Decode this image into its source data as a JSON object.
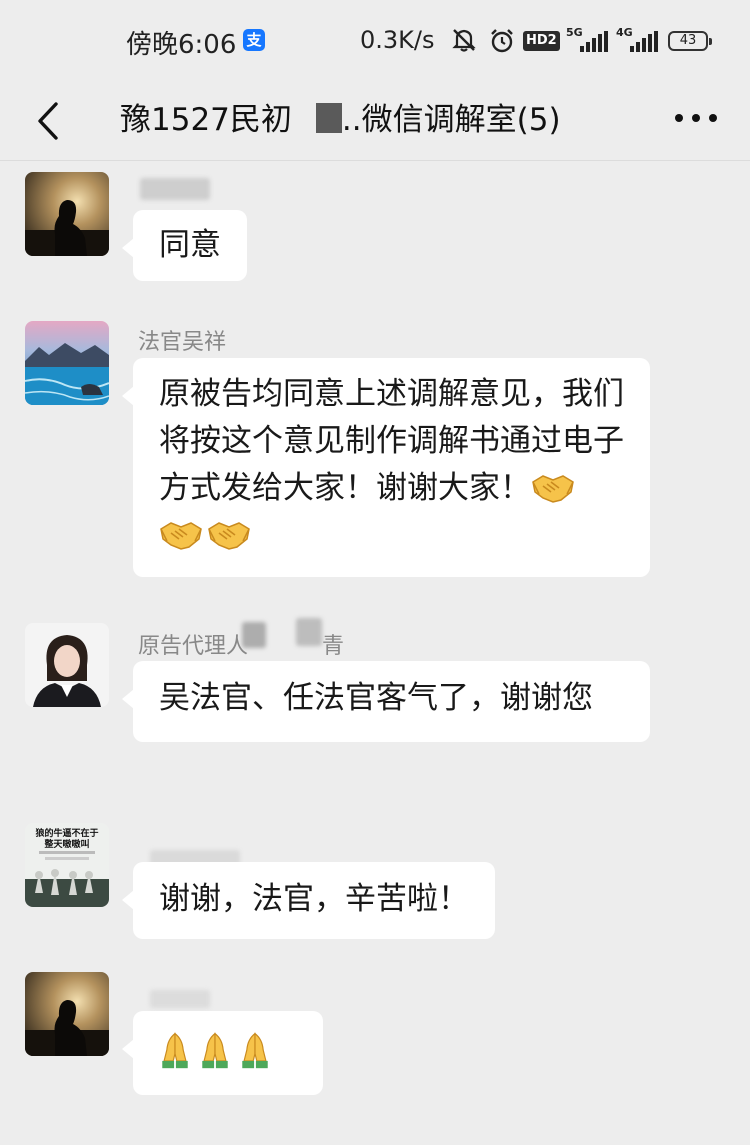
{
  "status_bar": {
    "time": "傍晚6:06",
    "alipay_badge": "支",
    "net_speed": "0.3K/s",
    "hd_badge": "HD2",
    "signal_1_label": "5G",
    "signal_2_label": "4G",
    "battery": "43"
  },
  "nav": {
    "title_prefix": "豫1527民初",
    "title_ellipsis": "..",
    "title_suffix": "微信调解室(5)"
  },
  "messages": [
    {
      "sender": "",
      "text": "同意",
      "avatar": "silhouette-sunset-avatar"
    },
    {
      "sender": "法官吴祥",
      "text": "原被告均同意上述调解意见，我们将按这个意见制作调解书通过电子方式发给大家！谢谢大家！",
      "emoji": [
        "handshake-emoji",
        "handshake-emoji",
        "handshake-emoji"
      ],
      "avatar": "landscape-lake-avatar"
    },
    {
      "sender": "原告代理人",
      "sender_tail": "青",
      "text": "吴法官、任法官客气了，谢谢您",
      "avatar": "woman-portrait-avatar"
    },
    {
      "sender": "",
      "text": "谢谢，法官，辛苦啦！",
      "avatar": "wolves-poster-avatar",
      "avatar_caption_1": "狼的牛逼不在于",
      "avatar_caption_2": "整天嗷嗷叫"
    },
    {
      "sender": "",
      "text": "",
      "emoji": [
        "folded-hands-emoji",
        "folded-hands-emoji",
        "folded-hands-emoji"
      ],
      "avatar": "silhouette-sunset-avatar"
    }
  ],
  "colors": {
    "background": "#ededed",
    "bubble": "#ffffff",
    "sender_name": "#888888"
  }
}
